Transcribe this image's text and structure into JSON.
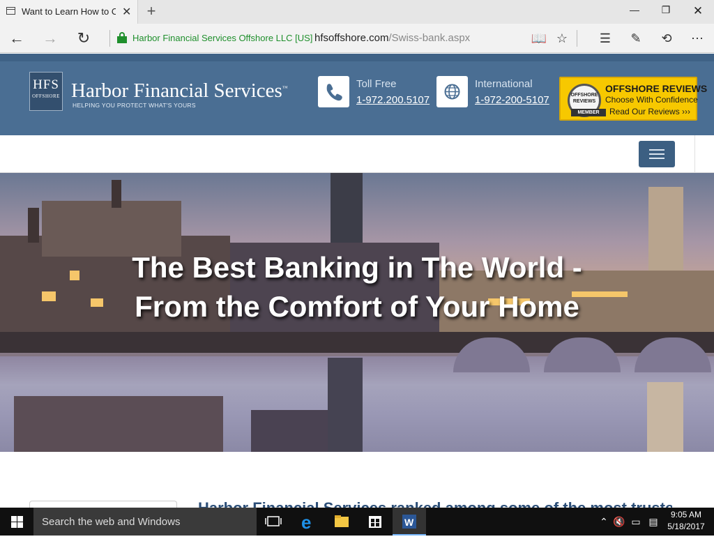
{
  "browser": {
    "tab_title": "Want to Learn How to O",
    "new_tab_symbol": "+",
    "cert_name": "Harbor Financial Services Offshore LLC [US]",
    "url_domain": "hfsoffshore.com",
    "url_path": "/Swiss-bank.aspx",
    "window_controls": [
      "minimize",
      "restore",
      "close"
    ]
  },
  "site": {
    "logo_initials": "HFS",
    "logo_sub": "OFFSHORE",
    "brand_name": "Harbor Financial Services",
    "brand_tm": "™",
    "tagline": "HELPING YOU PROTECT WHAT'S YOURS",
    "contacts": [
      {
        "label": "Toll Free",
        "number": "1-972.200.5107",
        "icon": "phone-icon"
      },
      {
        "label": "International",
        "number": "1-972-200-5107",
        "icon": "globe-icon"
      }
    ],
    "badge": {
      "seal_line1": "OFFSHORE",
      "seal_line2": "REVIEWS",
      "seal_ribbon": "MEMBER",
      "title": "OFFSHORE REVIEWS",
      "subtitle": "Choose With Confidence",
      "link": "Read Our Reviews ›››"
    },
    "hero_title": "The Best Banking in The World - From the Comfort of Your Home",
    "partial_heading": "Harbor Financial Services ranked among some of the most trusted"
  },
  "taskbar": {
    "search_placeholder": "Search the web and Windows",
    "time": "9:05 AM",
    "date": "5/18/2017",
    "pinned": [
      "task-view-icon",
      "edge-icon",
      "file-explorer-icon",
      "store-icon",
      "word-icon"
    ]
  },
  "colors": {
    "header_bg": "#4a6e93",
    "menu_button": "#3c5f82",
    "badge_yellow": "#f7c800",
    "secure_green": "#1f8f2c"
  }
}
